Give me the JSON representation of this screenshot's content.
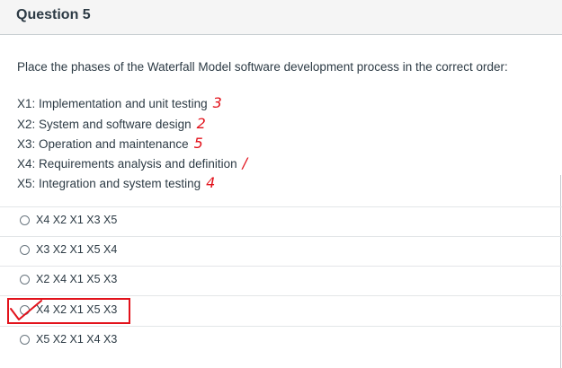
{
  "question": {
    "title": "Question 5"
  },
  "prompt": "Place the phases of the Waterfall Model software development process in the correct order:",
  "items": [
    {
      "text": "X1: Implementation and unit testing",
      "note": "3"
    },
    {
      "text": "X2: System and software design",
      "note": "2"
    },
    {
      "text": "X3: Operation and maintenance",
      "note": "5"
    },
    {
      "text": "X4: Requirements analysis and definition",
      "note": "/"
    },
    {
      "text": "X5: Integration and system testing",
      "note": "4"
    }
  ],
  "options": [
    {
      "label": "X4 X2 X1 X3 X5"
    },
    {
      "label": "X3 X2 X1 X5 X4"
    },
    {
      "label": "X2 X4 X1 X5 X3"
    },
    {
      "label": "X4 X2 X1 X5 X3"
    },
    {
      "label": "X5 X2 X1 X4 X3"
    }
  ],
  "colors": {
    "annotation": "#e2121b",
    "text": "#2d3b45",
    "header_bg": "#f5f5f5"
  }
}
